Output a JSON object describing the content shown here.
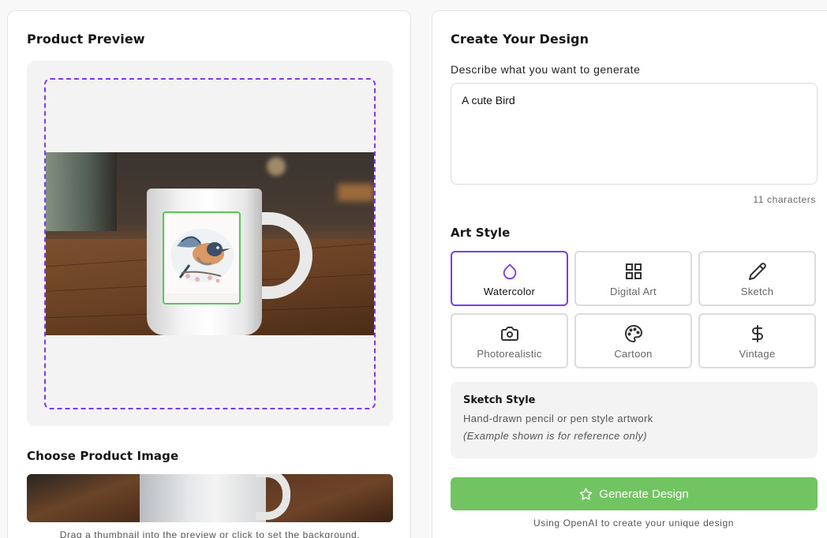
{
  "preview": {
    "title": "Product Preview"
  },
  "products": {
    "title": "Choose Product Image",
    "hint": "Drag a thumbnail into the preview or click to set the background."
  },
  "design": {
    "title": "Create Your Design",
    "prompt_label": "Describe what you want to generate",
    "prompt_value": "A cute Bird",
    "char_count": "11 characters",
    "art_style_title": "Art Style",
    "styles": [
      {
        "label": "Watercolor",
        "icon": "droplet-icon",
        "selected": true
      },
      {
        "label": "Digital Art",
        "icon": "grid-icon",
        "selected": false
      },
      {
        "label": "Sketch",
        "icon": "pencil-icon",
        "selected": false
      },
      {
        "label": "Photorealistic",
        "icon": "camera-icon",
        "selected": false
      },
      {
        "label": "Cartoon",
        "icon": "palette-icon",
        "selected": false
      },
      {
        "label": "Vintage",
        "icon": "dollar-icon",
        "selected": false
      }
    ],
    "info": {
      "title": "Sketch Style",
      "description": "Hand-drawn pencil or pen style artwork",
      "note": "(Example shown is for reference only)"
    },
    "generate_label": "Generate Design",
    "footer": "Using OpenAI to create your unique design"
  },
  "colors": {
    "accent": "#7c3aed",
    "generate_button": "#72c361",
    "design_frame": "#5ec35c"
  }
}
